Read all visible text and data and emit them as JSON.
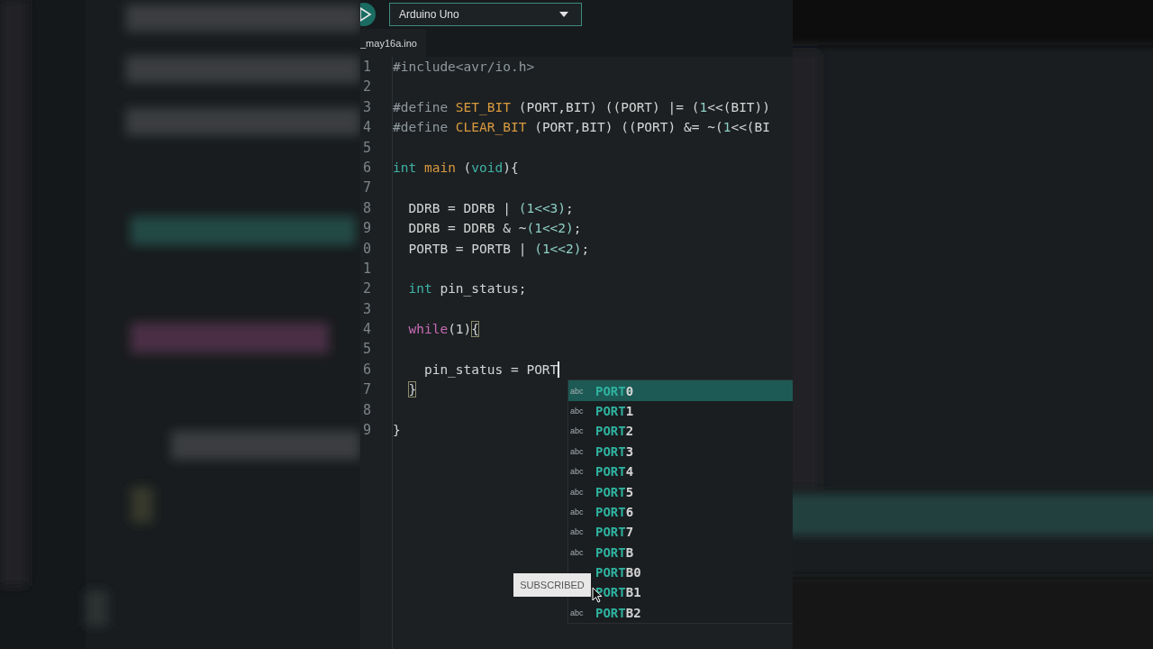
{
  "toolbar": {
    "board": "Arduino Uno"
  },
  "tab": {
    "label": "_may16a.ino"
  },
  "lines": [
    {
      "number": "1",
      "tokens": [
        {
          "kind": "preprocessor",
          "text": "#include<avr/io.h>"
        }
      ]
    },
    {
      "number": "2"
    },
    {
      "number": "3",
      "tokens": [
        {
          "kind": "preprocessor",
          "text": "#define "
        },
        {
          "kind": "macro",
          "text": "SET_BIT"
        },
        {
          "kind": "plain",
          "text": " (PORT,BIT) ((PORT) |= ("
        },
        {
          "kind": "number",
          "text": "1"
        },
        {
          "kind": "plain",
          "text": "<<(BIT))"
        }
      ]
    },
    {
      "number": "4",
      "tokens": [
        {
          "kind": "preprocessor",
          "text": "#define "
        },
        {
          "kind": "macro",
          "text": "CLEAR_BIT"
        },
        {
          "kind": "plain",
          "text": " (PORT,BIT) ((PORT) &= ~("
        },
        {
          "kind": "number",
          "text": "1"
        },
        {
          "kind": "plain",
          "text": "<<(BI"
        }
      ]
    },
    {
      "number": "5"
    },
    {
      "number": "6",
      "tokens": [
        {
          "kind": "type",
          "text": "int"
        },
        {
          "kind": "function",
          "text": " main"
        },
        {
          "kind": "plain",
          "text": " ("
        },
        {
          "kind": "type",
          "text": "void"
        },
        {
          "kind": "plain",
          "text": "){"
        }
      ]
    },
    {
      "number": "7"
    },
    {
      "number": "8",
      "tokens": [
        {
          "kind": "plain",
          "text": "  DDRB = DDRB | "
        },
        {
          "kind": "number",
          "text": "(1<<3)"
        },
        {
          "kind": "plain",
          "text": ";"
        }
      ]
    },
    {
      "number": "9",
      "tokens": [
        {
          "kind": "plain",
          "text": "  DDRB = DDRB & ~"
        },
        {
          "kind": "number",
          "text": "(1<<2)"
        },
        {
          "kind": "plain",
          "text": ";"
        }
      ]
    },
    {
      "number": "0",
      "tokens": [
        {
          "kind": "plain",
          "text": "  PORTB = PORTB | "
        },
        {
          "kind": "number",
          "text": "(1<<2)"
        },
        {
          "kind": "plain",
          "text": ";"
        }
      ]
    },
    {
      "number": "1"
    },
    {
      "number": "2",
      "tokens": [
        {
          "kind": "type",
          "text": "  int"
        },
        {
          "kind": "plain",
          "text": " pin_status;"
        }
      ]
    },
    {
      "number": "3"
    },
    {
      "number": "4",
      "tokens": [
        {
          "kind": "control",
          "text": "  while"
        },
        {
          "kind": "plain",
          "text": "(1)"
        },
        {
          "kind": "bracket",
          "text": "{"
        }
      ]
    },
    {
      "number": "5"
    },
    {
      "number": "6",
      "cursor": true,
      "tokens": [
        {
          "kind": "plain",
          "text": "    pin_status = PORT"
        }
      ]
    },
    {
      "number": "7",
      "tokens": [
        {
          "kind": "bracket",
          "text": "  }"
        }
      ]
    },
    {
      "number": "8"
    },
    {
      "number": "9",
      "tokens": [
        {
          "kind": "plain",
          "text": "}"
        }
      ]
    }
  ],
  "suggestions": [
    {
      "icon": "abc",
      "match": "PORT",
      "rest": "0",
      "selected": true
    },
    {
      "icon": "abc",
      "match": "PORT",
      "rest": "1",
      "selected": false
    },
    {
      "icon": "abc",
      "match": "PORT",
      "rest": "2",
      "selected": false
    },
    {
      "icon": "abc",
      "match": "PORT",
      "rest": "3",
      "selected": false
    },
    {
      "icon": "abc",
      "match": "PORT",
      "rest": "4",
      "selected": false
    },
    {
      "icon": "abc",
      "match": "PORT",
      "rest": "5",
      "selected": false
    },
    {
      "icon": "abc",
      "match": "PORT",
      "rest": "6",
      "selected": false
    },
    {
      "icon": "abc",
      "match": "PORT",
      "rest": "7",
      "selected": false
    },
    {
      "icon": "abc",
      "match": "PORT",
      "rest": "B",
      "selected": false
    },
    {
      "match": "PORT",
      "rest": "B0",
      "selected": false
    },
    {
      "match": "PORT",
      "rest": "B1",
      "selected": false
    },
    {
      "icon": "abc",
      "match": "PORT",
      "rest": "B2",
      "selected": false
    }
  ],
  "overlay": {
    "label": "SUBSCRIBED"
  }
}
